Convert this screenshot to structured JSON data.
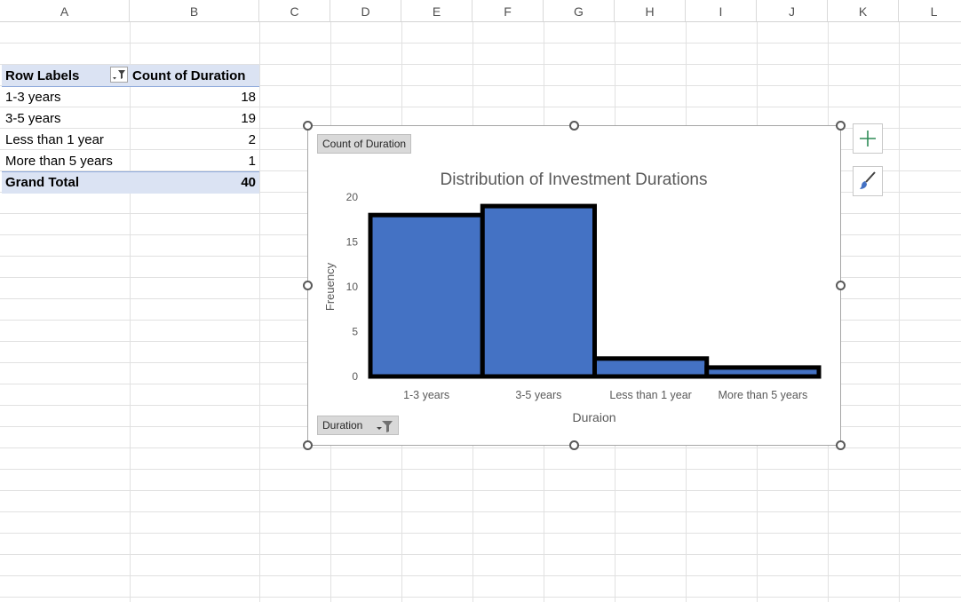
{
  "columns": [
    "A",
    "B",
    "C",
    "D",
    "E",
    "F",
    "G",
    "H",
    "I",
    "J",
    "K",
    "L"
  ],
  "pivot": {
    "header_row_label": "Row Labels",
    "header_value_label": "Count of Duration",
    "rows": [
      {
        "label": "1-3 years",
        "value": "18"
      },
      {
        "label": "3-5 years",
        "value": "19"
      },
      {
        "label": "Less than 1 year",
        "value": "2"
      },
      {
        "label": "More than 5 years",
        "value": "1"
      }
    ],
    "total_label": "Grand Total",
    "total_value": "40"
  },
  "chart": {
    "value_field_button": "Count of Duration",
    "axis_field_button": "Duration"
  },
  "chart_data": {
    "type": "bar",
    "title": "Distribution of Investment Durations",
    "xlabel": "Duraion",
    "ylabel": "Freuency",
    "categories": [
      "1-3 years",
      "3-5 years",
      "Less than 1 year",
      "More than 5 years"
    ],
    "values": [
      18,
      19,
      2,
      1
    ],
    "ylim": [
      0,
      20
    ],
    "yticks": [
      0,
      5,
      10,
      15,
      20
    ],
    "bar_color": "#4472c4",
    "bar_edge_color": "#000000",
    "gap_width": 0,
    "legend": false,
    "grid": false
  },
  "colors": {
    "pivot_header_bg": "#dbe3f3",
    "chart_add_icon": "#2e8b57"
  },
  "icons": {
    "chart_add": "plus-icon",
    "chart_style": "paintbrush-icon",
    "filter": "filter-icon"
  }
}
